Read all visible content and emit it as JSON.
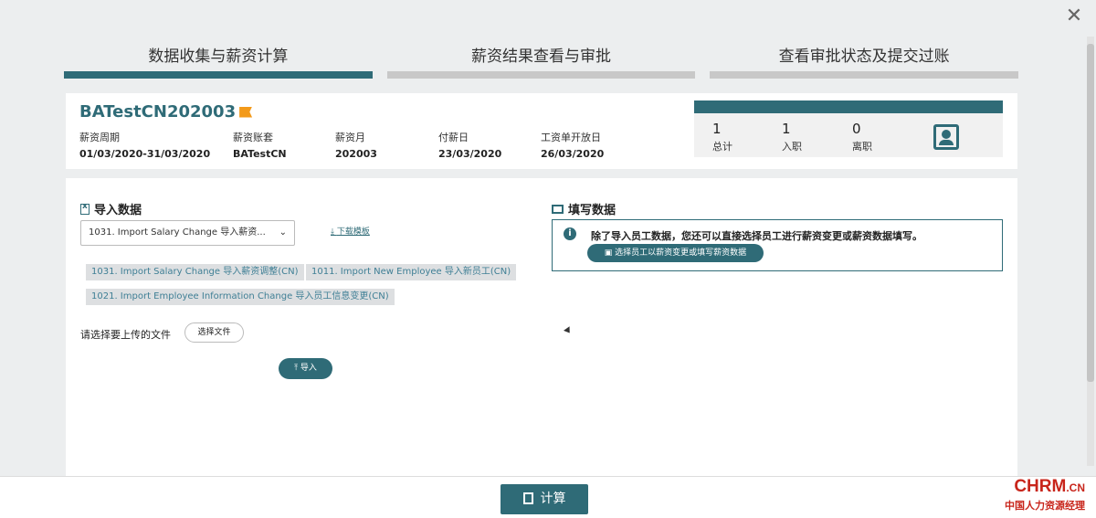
{
  "steps": [
    {
      "label": "数据收集与薪资计算"
    },
    {
      "label": "薪资结果查看与审批"
    },
    {
      "label": "查看审批状态及提交过账"
    }
  ],
  "summary": {
    "title": "BATestCN202003",
    "fields": [
      {
        "label": "薪资周期",
        "value": "01/03/2020-31/03/2020"
      },
      {
        "label": "薪资账套",
        "value": "BATestCN"
      },
      {
        "label": "薪资月",
        "value": "202003"
      },
      {
        "label": "付薪日",
        "value": "23/03/2020"
      },
      {
        "label": "工资单开放日",
        "value": "26/03/2020"
      }
    ],
    "stats": [
      {
        "value": "1",
        "label": "总计"
      },
      {
        "value": "1",
        "label": "入职"
      },
      {
        "value": "0",
        "label": "离职"
      }
    ]
  },
  "import": {
    "title": "导入数据",
    "selected": "1031. Import Salary Change 导入薪资...",
    "download_label": "下载模板",
    "chips": [
      "1031. Import Salary Change 导入薪资调整(CN)",
      "1011. Import New Employee 导入新员工(CN)",
      "1021. Import Employee Information Change 导入员工信息变更(CN)"
    ],
    "file_label": "请选择要上传的文件",
    "file_button": "选择文件",
    "import_button": "导入"
  },
  "fill": {
    "title": "填写数据",
    "info_text": "除了导入员工数据，您还可以直接选择员工进行薪资变更或薪资数据填写。",
    "choose_button": "选择员工以薪资变更或填写薪资数据"
  },
  "footer": {
    "calc_button": "计算",
    "logo_brand": "CHRM",
    "logo_tld": ".CN",
    "logo_sub": "中国人力资源经理"
  },
  "colors": {
    "accent": "#2f6b77",
    "flag": "#f39a1a",
    "logo": "#c8251b"
  }
}
